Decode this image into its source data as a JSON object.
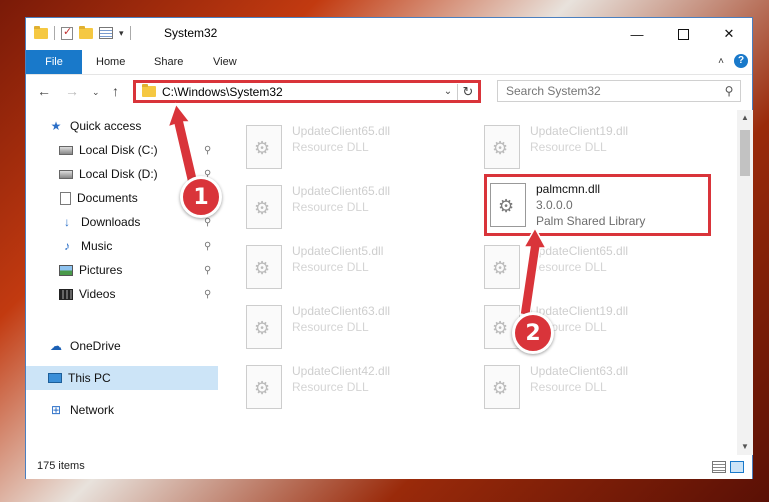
{
  "window": {
    "title": "System32",
    "min_glyph": "—",
    "close_glyph": "✕"
  },
  "ribbon": {
    "tabs": [
      "File",
      "Home",
      "Share",
      "View"
    ],
    "help": "?",
    "collapse": "˄"
  },
  "nav": {
    "back": "←",
    "forward": "→",
    "recent": "⌄",
    "up": "↑",
    "address": "C:\\Windows\\System32",
    "address_dropdown": "⌄",
    "refresh": "↻",
    "search_placeholder": "Search System32",
    "search_icon": "⚲"
  },
  "sidebar": {
    "items": [
      {
        "label": "Quick access",
        "icon": "star-icon",
        "pinned": false
      },
      {
        "label": "Local Disk (C:)",
        "icon": "drive-icon",
        "pinned": true
      },
      {
        "label": "Local Disk (D:)",
        "icon": "drive-icon",
        "pinned": true
      },
      {
        "label": "Documents",
        "icon": "document-icon",
        "pinned": true
      },
      {
        "label": "Downloads",
        "icon": "download-icon",
        "pinned": true
      },
      {
        "label": "Music",
        "icon": "music-icon",
        "pinned": true
      },
      {
        "label": "Pictures",
        "icon": "pictures-icon",
        "pinned": true
      },
      {
        "label": "Videos",
        "icon": "videos-icon",
        "pinned": true
      },
      {
        "label": "OneDrive",
        "icon": "cloud-icon",
        "pinned": false
      },
      {
        "label": "This PC",
        "icon": "computer-icon",
        "pinned": false,
        "selected": true
      },
      {
        "label": "Network",
        "icon": "network-icon",
        "pinned": false
      }
    ],
    "pin_glyph": "📌"
  },
  "files": {
    "col1": [
      {
        "name": "UpdateClient65.dll",
        "type": "Resource DLL"
      },
      {
        "name": "UpdateClient65.dll",
        "type": "Resource DLL"
      },
      {
        "name": "UpdateClient5.dll",
        "type": "Resource DLL"
      },
      {
        "name": "UpdateClient63.dll",
        "type": "Resource DLL"
      },
      {
        "name": "UpdateClient42.dll",
        "type": "Resource DLL"
      }
    ],
    "col2": [
      {
        "name": "UpdateClient19.dll",
        "type": "Resource DLL"
      },
      {
        "name": "palmcmn.dll",
        "version": "3.0.0.0",
        "type": "Palm Shared Library",
        "highlighted": true
      },
      {
        "name": "UpdateClient65.dll",
        "type": "Resource DLL"
      },
      {
        "name": "UpdateClient19.dll",
        "type": "Resource DLL"
      },
      {
        "name": "UpdateClient63.dll",
        "type": "Resource DLL"
      }
    ]
  },
  "status": {
    "item_count": "175 items"
  },
  "annotations": {
    "step1": "1",
    "step2": "2",
    "color": "#d9343a"
  }
}
